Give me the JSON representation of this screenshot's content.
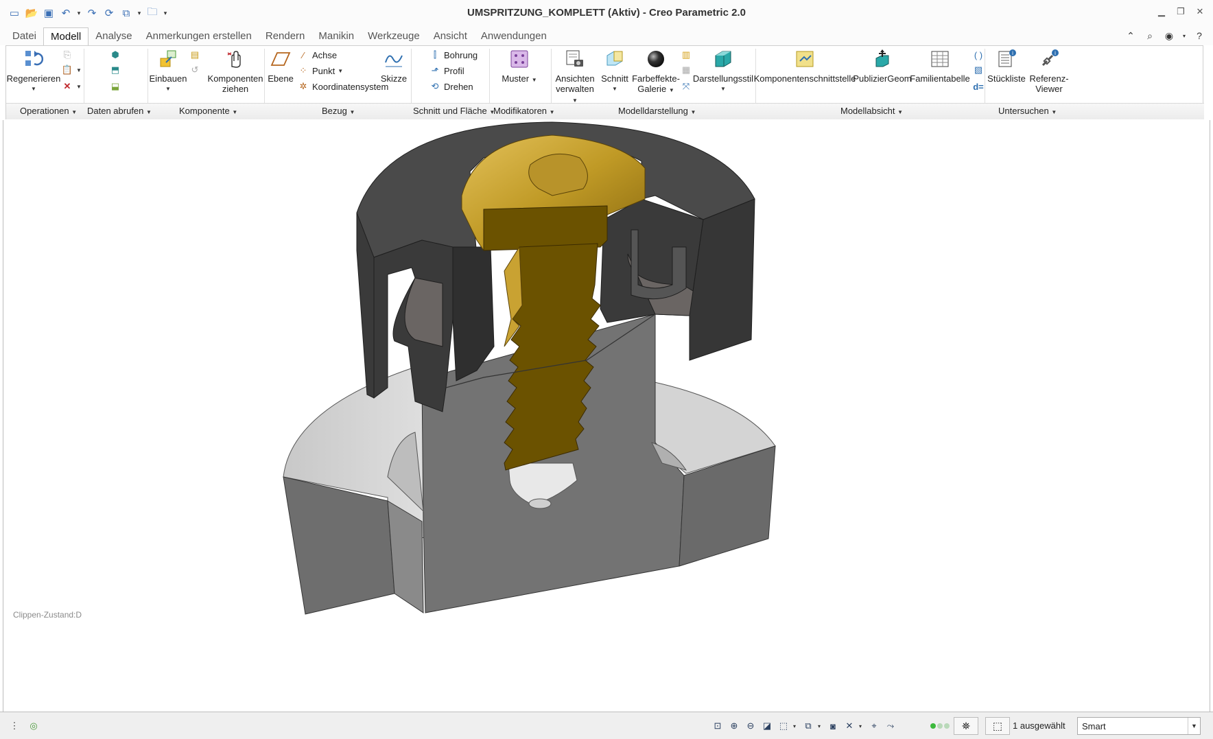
{
  "window": {
    "title": "UMSPRITZUNG_KOMPLETT (Aktiv) - Creo Parametric 2.0"
  },
  "tabs": [
    "Datei",
    "Modell",
    "Analyse",
    "Anmerkungen erstellen",
    "Rendern",
    "Manikin",
    "Werkzeuge",
    "Ansicht",
    "Anwendungen"
  ],
  "active_tab": "Modell",
  "ribbon": {
    "operationen": {
      "regenerieren": "Regenerieren"
    },
    "komponente": {
      "einbauen": "Einbauen",
      "komponenten_ziehen_1": "Komponenten",
      "komponenten_ziehen_2": "ziehen"
    },
    "bezug": {
      "ebene": "Ebene",
      "achse": "Achse",
      "punkt": "Punkt",
      "koordinatensystem": "Koordinatensystem",
      "skizze": "Skizze"
    },
    "schnitt": {
      "bohrung": "Bohrung",
      "profil": "Profil",
      "drehen": "Drehen"
    },
    "modifikatoren": {
      "muster": "Muster"
    },
    "modelldarstellung": {
      "ansichten_1": "Ansichten",
      "ansichten_2": "verwalten",
      "schnitt": "Schnitt",
      "farbeffekte_1": "Farbeffekte-",
      "farbeffekte_2": "Galerie",
      "darstellungsstil": "Darstellungsstil"
    },
    "modellabsicht": {
      "komponentenschnittstelle": "Komponentenschnittstelle",
      "publiziergeom": "PublizierGeom",
      "familientabelle": "Familientabelle"
    },
    "untersuchen": {
      "stueckliste": "Stückliste",
      "referenz_1": "Referenz-",
      "referenz_2": "Viewer",
      "d_equals": "d="
    }
  },
  "group_labels": {
    "operationen": "Operationen",
    "daten_abrufen": "Daten abrufen",
    "komponente": "Komponente",
    "bezug": "Bezug",
    "schnitt_flaeche": "Schnitt und Fläche",
    "modifikatoren": "Modifikatoren",
    "modelldarstellung": "Modelldarstellung",
    "modellabsicht": "Modellabsicht",
    "untersuchen": "Untersuchen"
  },
  "canvas": {
    "clip_state": "Clippen-Zustand:D"
  },
  "statusbar": {
    "selected": "1 ausgewählt",
    "filter": "Smart",
    "status_colors": [
      "#3cb93c",
      "#b9d9b9",
      "#b9d9b9"
    ]
  },
  "icons": [
    "regenerate-icon",
    "assemble-icon",
    "drag-components-icon",
    "plane-icon",
    "axis-icon",
    "point-icon",
    "csys-icon",
    "sketch-icon",
    "hole-icon",
    "profile-icon",
    "revolve-icon",
    "pattern-icon",
    "manage-views-icon",
    "section-icon",
    "appearance-gallery-icon",
    "display-style-icon",
    "component-interface-icon",
    "publish-geom-icon",
    "family-table-icon",
    "bom-icon",
    "reference-viewer-icon"
  ]
}
